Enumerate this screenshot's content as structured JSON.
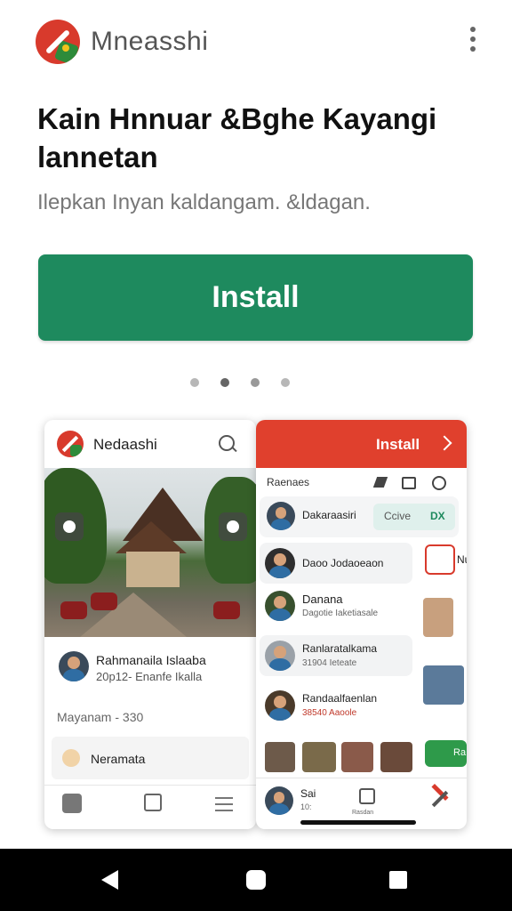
{
  "header": {
    "app_name": "Mneasshi",
    "menu_icon": "kebab-menu-icon"
  },
  "hero": {
    "title": "Kain Hnnuar &Bghe Kayangi lannetan",
    "subtitle": "Ilepkan Inyan kaldangam. &ldagan."
  },
  "install_button": {
    "label": "Install"
  },
  "carousel": {
    "count": 4,
    "active_index": 1
  },
  "preview_left": {
    "app_name": "Nedaashi",
    "profile": {
      "name": "Rahmanaila Islaaba",
      "meta": "20p12- Enanfe Ikalla"
    },
    "price": "Mayanam - 330",
    "item_label": "Neramata"
  },
  "preview_right": {
    "header_label": "Install",
    "toolbar_label": "Raenaes",
    "rows": [
      {
        "name": "Dakaraasiri",
        "chips": [
          "Ccive",
          "DX"
        ]
      },
      {
        "name": "Daoo Jodaoeaon",
        "sub": ""
      },
      {
        "name": "Danana",
        "sub": "Dagotie Iaketiasale"
      },
      {
        "name": "Ranlaratalkama",
        "sub": "31904 Ieteate"
      },
      {
        "name": "Randaalfaenlan",
        "sub": "38540 Aaoole"
      }
    ],
    "side_labels": [
      "Nu",
      "Ra"
    ],
    "bottom_nav": {
      "label": "Sai",
      "sub": "10:",
      "mid": "Rasdan"
    }
  },
  "colors": {
    "accent_green": "#1e8a5e",
    "accent_red": "#e0402d"
  }
}
